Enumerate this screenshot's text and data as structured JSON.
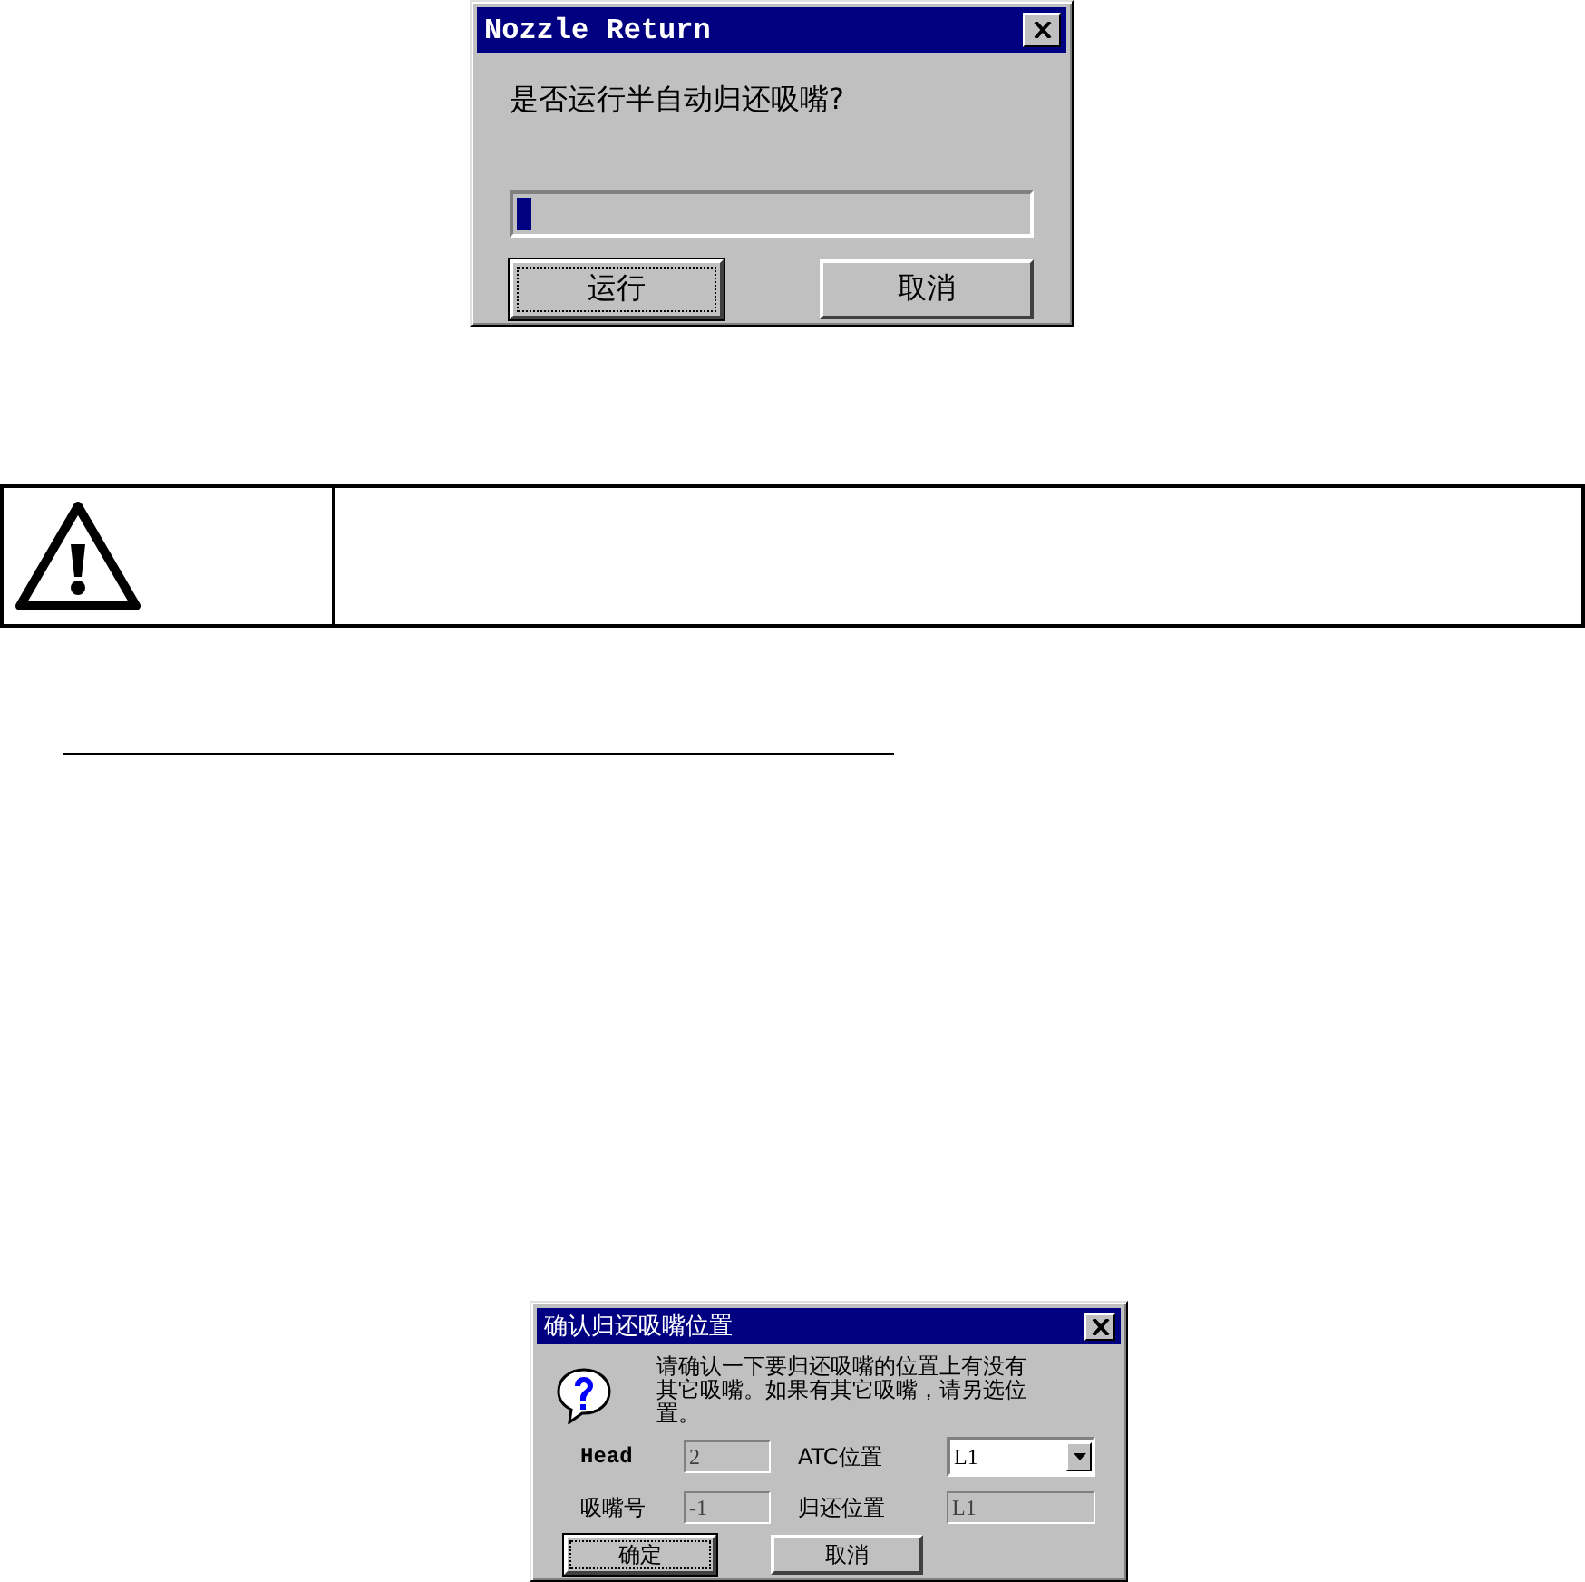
{
  "dialogs": [
    {
      "title": "Nozzle Return",
      "message": "是否运行半自动归还吸嘴?",
      "progress": {
        "level": 0.03
      },
      "buttons": [
        {
          "label": "运行",
          "default": true
        },
        {
          "label": "取消",
          "default": false
        }
      ]
    },
    {
      "title": "确认归还吸嘴位置",
      "message": "请确认一下要归还吸嘴的位置上有没有其它吸嘴。如果有其它吸嘴，请另选位置。",
      "fields": [
        {
          "label": "Head",
          "value": "2",
          "kind": "text",
          "disabled": true
        },
        {
          "label": "ATC位置",
          "value": "L1",
          "kind": "combo",
          "disabled": false
        },
        {
          "label": "吸嘴号",
          "value": "-1",
          "kind": "text",
          "disabled": true
        },
        {
          "label": "归还位置",
          "value": "L1",
          "kind": "text",
          "disabled": true
        }
      ],
      "buttons": [
        {
          "label": "确定",
          "default": true
        },
        {
          "label": "取消",
          "default": false
        }
      ]
    }
  ]
}
